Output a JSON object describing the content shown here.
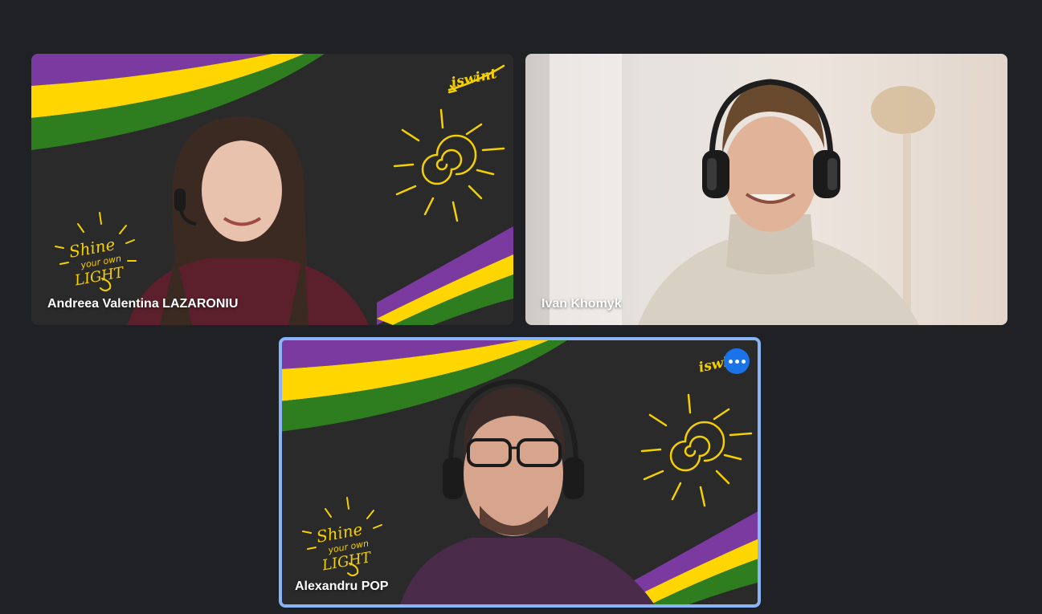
{
  "participants": [
    {
      "name": "Andreea Valentina LAZARONIU",
      "background": "chalkboard",
      "logo_text": "iswint",
      "doodle_text": [
        "Shine",
        "your own",
        "LIGHT"
      ]
    },
    {
      "name": "Ivan Khomyk",
      "background": "room"
    },
    {
      "name": "Alexandru POP",
      "background": "chalkboard",
      "logo_text": "iswint",
      "doodle_text": [
        "Shine",
        "your own",
        "LIGHT"
      ],
      "active_speaker": true,
      "more_options_icon": "more-horizontal-icon"
    }
  ],
  "colors": {
    "app_background": "#202124",
    "active_border": "#8ab4f8",
    "more_button": "#1a73e8",
    "band_purple": "#7b3aa0",
    "band_yellow": "#ffd600",
    "band_green": "#2e7d1e",
    "doodle_yellow": "#f5d000"
  }
}
